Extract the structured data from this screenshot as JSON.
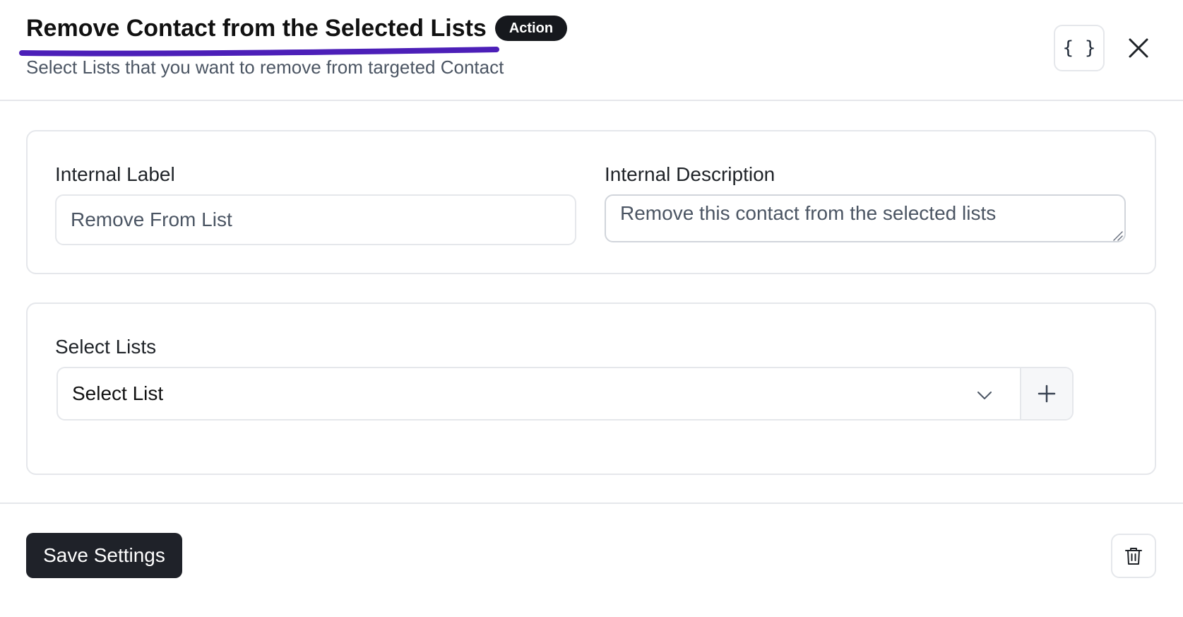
{
  "header": {
    "title": "Remove Contact from the Selected Lists",
    "badge": "Action",
    "subtitle": "Select Lists that you want to remove from targeted Contact",
    "code_button_label": "{ }",
    "accent_underline_color": "#4c1fb8"
  },
  "settings": {
    "internal_label": {
      "label": "Internal Label",
      "value": "Remove From List"
    },
    "internal_description": {
      "label": "Internal Description",
      "value": "Remove this contact from the selected lists"
    }
  },
  "lists": {
    "label": "Select Lists",
    "select_value": "Select List"
  },
  "footer": {
    "save_label": "Save Settings"
  },
  "icons": {
    "code": "code-braces-icon",
    "close": "close-icon",
    "chevron": "chevron-down-icon",
    "add": "plus-icon",
    "delete": "trash-icon"
  }
}
